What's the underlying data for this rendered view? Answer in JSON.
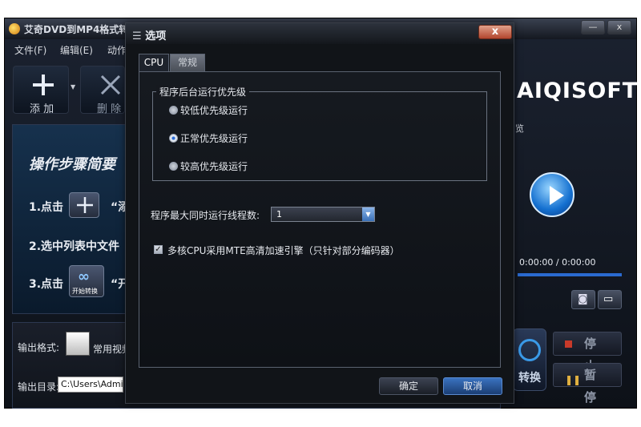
{
  "app": {
    "title": "艾奇DVD到MP4格式转",
    "menu": [
      "文件(F)",
      "编辑(E)",
      "动作"
    ],
    "toolbar": {
      "add_label": "添 加",
      "delete_label": "删 除"
    },
    "steps": {
      "title": "操作步骤简要",
      "step1_text": "1.点击",
      "step1_quote": "“添",
      "step2_text": "2.选中列表中文件",
      "step3_text": "3.点击",
      "step3_quote": "“开",
      "convert_icon_caption": "开始转换"
    },
    "output": {
      "format_label": "输出格式:",
      "format_value": "常用视频",
      "dir_label": "输出目录:",
      "dir_value": "C:\\Users\\Admin"
    },
    "brand": "AIQISOFT",
    "preview_label": "览",
    "time": "0:00:00 / 0:00:00",
    "stop_label": "停 止",
    "pause_label": "暂 停",
    "convert_label": "转换"
  },
  "dialog": {
    "title": "选项",
    "close_label": "x",
    "tabs": [
      {
        "label": "CPU",
        "active": true
      },
      {
        "label": "常规",
        "active": false
      }
    ],
    "priority": {
      "group_title": "程序后台运行优先级",
      "options": [
        {
          "label": "较低优先级运行",
          "checked": false
        },
        {
          "label": "正常优先级运行",
          "checked": true
        },
        {
          "label": "较高优先级运行",
          "checked": false
        }
      ]
    },
    "threads": {
      "label": "程序最大同时运行线程数:",
      "value": "1"
    },
    "mte": {
      "label": "多核CPU采用MTE高清加速引擎（只针对部分编码器）",
      "checked": true
    },
    "ok_label": "确定",
    "cancel_label": "取消"
  },
  "colors": {
    "accent": "#2a6ad0",
    "close_red": "#b2462e"
  }
}
